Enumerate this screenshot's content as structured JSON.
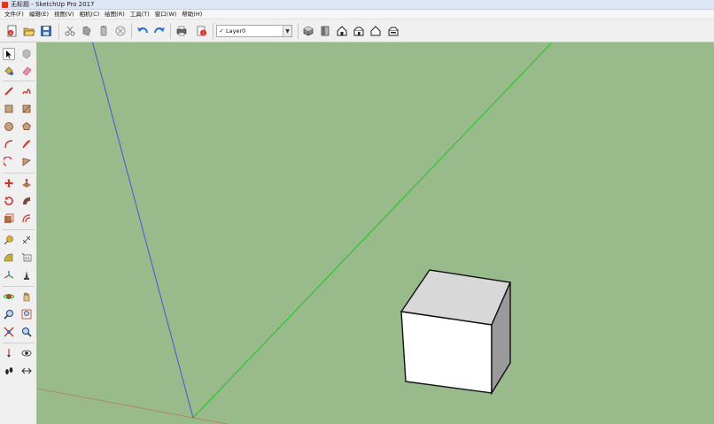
{
  "window": {
    "title": "无标题 - SketchUp Pro 2017"
  },
  "menu": {
    "items": [
      "文件(F)",
      "编辑(E)",
      "视图(V)",
      "相机(C)",
      "绘图(R)",
      "工具(T)",
      "窗口(W)",
      "帮助(H)"
    ]
  },
  "toolbar": {
    "icons": [
      "new-model-icon",
      "open-icon",
      "save-icon",
      "cut-icon",
      "copy-icon",
      "paste-icon",
      "erase-icon",
      "undo-icon",
      "redo-icon",
      "print-icon",
      "model-info-icon",
      "iso-view-icon",
      "top-view-icon",
      "front-view-icon",
      "right-view-icon",
      "back-view-icon",
      "left-view-icon"
    ],
    "layer": {
      "check": "✓",
      "current": "Layer0"
    }
  },
  "palette": {
    "tools": [
      "select",
      "make-component",
      "paint-bucket",
      "eraser",
      "line",
      "freehand",
      "rectangle",
      "rotated-rectangle",
      "circle",
      "polygon",
      "arc",
      "pie",
      "2-point-arc",
      "3-point-arc",
      "move",
      "push-pull",
      "rotate",
      "follow-me",
      "scale",
      "offset",
      "tape-measure",
      "dimension",
      "protractor",
      "text",
      "axes",
      "3d-text",
      "orbit",
      "pan",
      "zoom",
      "zoom-window",
      "zoom-extents",
      "previous-view",
      "position-camera",
      "look-around",
      "walk",
      "section-plane"
    ],
    "selected_tool": "select"
  },
  "colors": {
    "viewport_bg": "#99bb8c",
    "axis_blue": "#3b5bd3",
    "axis_green": "#1fc41f",
    "axis_red": "#c0504d",
    "cube_top": "#d8d8d8",
    "cube_front": "#ffffff",
    "cube_side": "#9a9a9a"
  }
}
